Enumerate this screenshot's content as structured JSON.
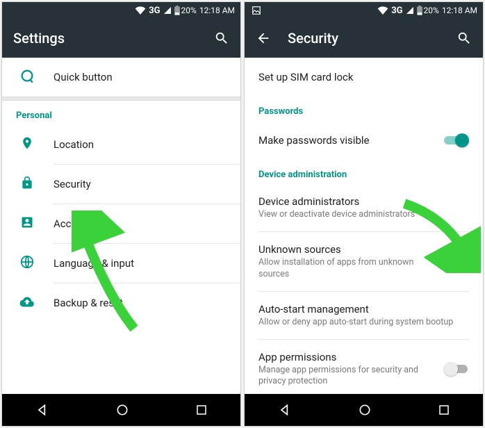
{
  "status": {
    "network": "3G",
    "battery": "20%",
    "time": "12:18 AM"
  },
  "left": {
    "title": "Settings",
    "quick_button": "Quick button",
    "personal_header": "Personal",
    "items": {
      "location": "Location",
      "security": "Security",
      "accounts": "Accounts",
      "language": "Language & input",
      "backup": "Backup & reset"
    }
  },
  "right": {
    "title": "Security",
    "sim_header_cut": "SIM card lock",
    "sim_lock": "Set up SIM card lock",
    "passwords_header": "Passwords",
    "make_pw_visible": "Make passwords visible",
    "device_admin_header": "Device administration",
    "device_admins": {
      "title": "Device administrators",
      "sub": "View or deactivate device administrators"
    },
    "unknown_sources": {
      "title": "Unknown sources",
      "sub": "Allow installation of apps from unknown sources"
    },
    "auto_start": {
      "title": "Auto-start management",
      "sub": "Allow or deny app auto-start during system bootup"
    },
    "app_perms": {
      "title": "App permissions",
      "sub": "Manage app permissions for security and privacy protection"
    }
  }
}
